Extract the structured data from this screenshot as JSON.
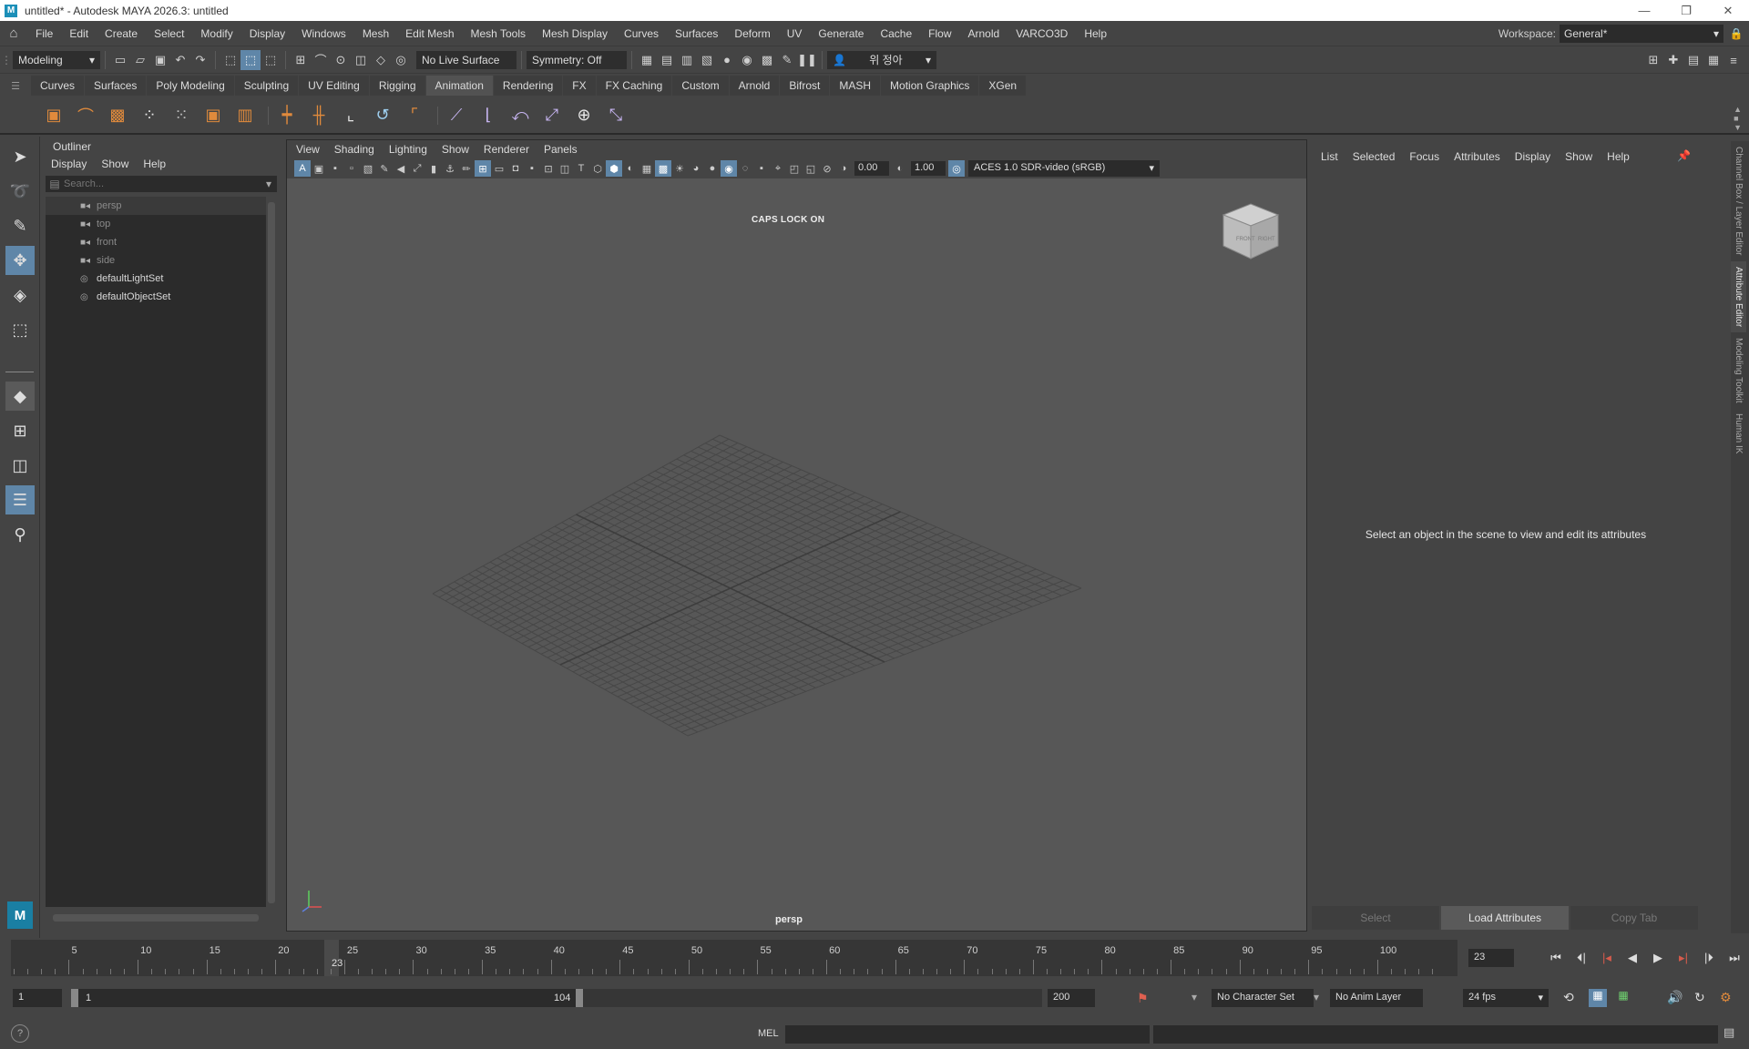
{
  "window": {
    "logo": "M",
    "title": "untitled* - Autodesk MAYA 2026.3: untitled",
    "controls": [
      "—",
      "❐",
      "✕"
    ]
  },
  "menubar": {
    "items": [
      "File",
      "Edit",
      "Create",
      "Select",
      "Modify",
      "Display",
      "Windows",
      "Mesh",
      "Edit Mesh",
      "Mesh Tools",
      "Mesh Display",
      "Curves",
      "Surfaces",
      "Deform",
      "UV",
      "Generate",
      "Cache",
      "Flow",
      "Arnold",
      "VARCO3D",
      "Help"
    ],
    "workspace_label": "Workspace:",
    "workspace_value": "General*"
  },
  "statusline": {
    "mode": "Modeling",
    "live_surface": "No Live Surface",
    "symmetry": "Symmetry: Off",
    "user": "위 정아"
  },
  "shelf": {
    "tabs": [
      "Curves",
      "Surfaces",
      "Poly Modeling",
      "Sculpting",
      "UV Editing",
      "Rigging",
      "Animation",
      "Rendering",
      "FX",
      "FX Caching",
      "Custom",
      "Arnold",
      "Bifrost",
      "MASH",
      "Motion Graphics",
      "XGen"
    ],
    "active_tab": "Animation"
  },
  "outliner": {
    "title": "Outliner",
    "menu": [
      "Display",
      "Show",
      "Help"
    ],
    "search_placeholder": "Search...",
    "items": [
      {
        "label": "persp",
        "kind": "camera"
      },
      {
        "label": "top",
        "kind": "camera"
      },
      {
        "label": "front",
        "kind": "camera"
      },
      {
        "label": "side",
        "kind": "camera"
      },
      {
        "label": "defaultLightSet",
        "kind": "set"
      },
      {
        "label": "defaultObjectSet",
        "kind": "set"
      }
    ]
  },
  "viewport": {
    "menu": [
      "View",
      "Shading",
      "Lighting",
      "Show",
      "Renderer",
      "Panels"
    ],
    "exposure": "0.00",
    "gamma": "1.00",
    "color_space": "ACES 1.0 SDR-video (sRGB)",
    "caps_lock": "CAPS LOCK ON",
    "camera": "persp",
    "viewcube_front": "FRONT",
    "viewcube_right": "RIGHT"
  },
  "attribute_editor": {
    "menu": [
      "List",
      "Selected",
      "Focus",
      "Attributes",
      "Display",
      "Show",
      "Help"
    ],
    "message": "Select an object in the scene to view and edit its attributes",
    "buttons": {
      "select": "Select",
      "load": "Load Attributes",
      "copy": "Copy Tab"
    }
  },
  "side_tabs": [
    "Channel Box / Layer Editor",
    "Attribute Editor",
    "Modeling Toolkit",
    "Human IK"
  ],
  "timeline": {
    "tick_labels": [
      "5",
      "10",
      "15",
      "20",
      "25",
      "30",
      "35",
      "40",
      "45",
      "50",
      "55",
      "60",
      "65",
      "70",
      "75",
      "80",
      "85",
      "90",
      "95",
      "100"
    ],
    "current_frame": "23",
    "current_frame_field": "23"
  },
  "range": {
    "start": "1",
    "range_start": "1",
    "range_end": "104",
    "end": "200",
    "character_set": "No Character Set",
    "anim_layer": "No Anim Layer",
    "fps": "24 fps"
  },
  "commandline": {
    "help": "?",
    "language": "MEL"
  }
}
